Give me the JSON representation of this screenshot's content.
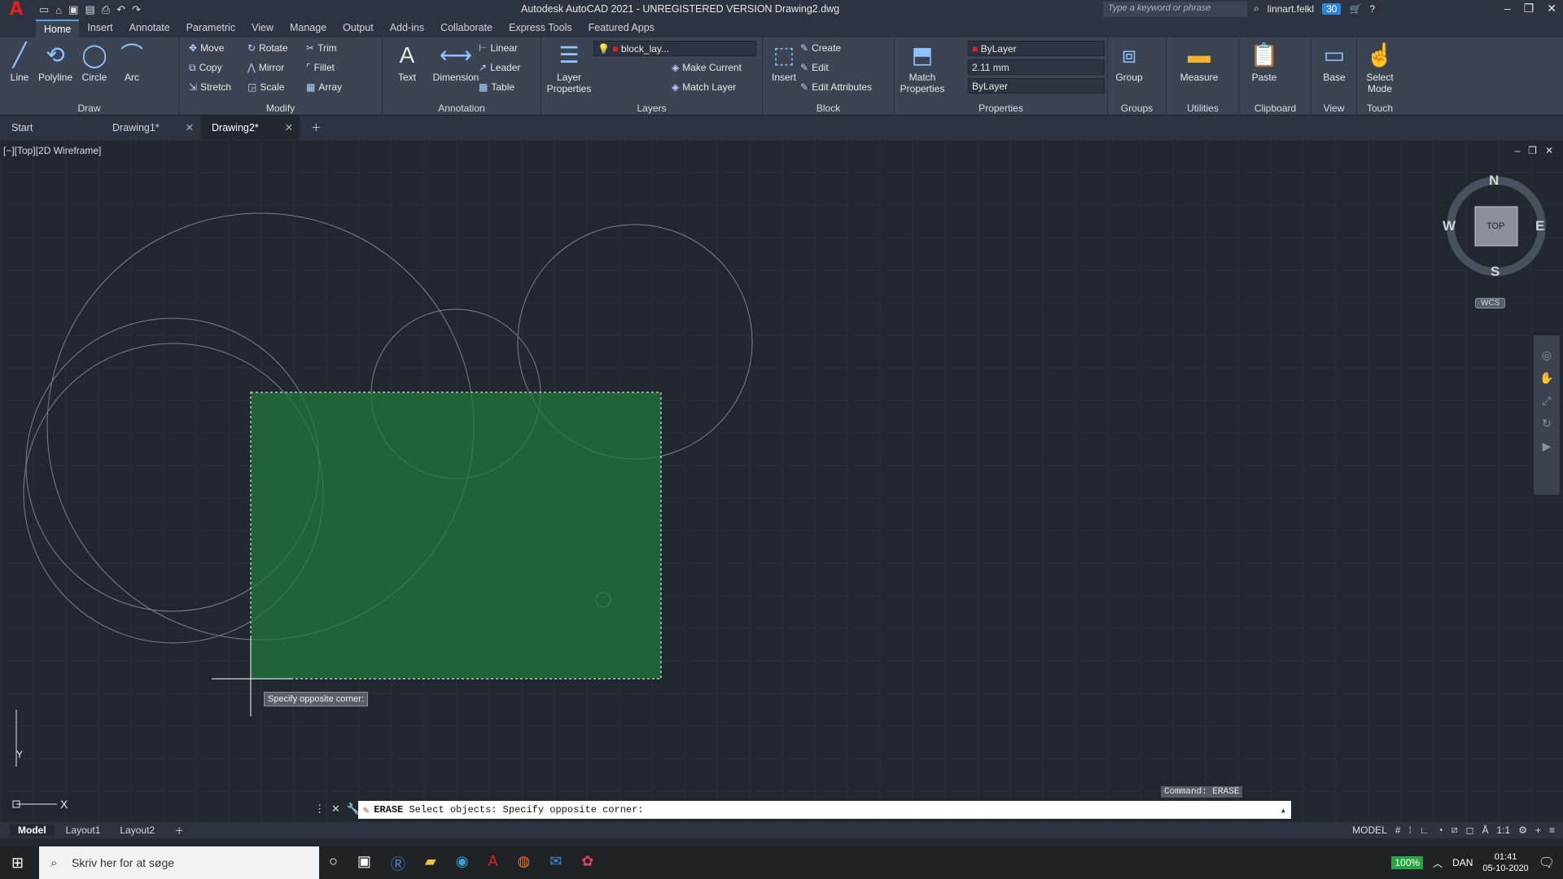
{
  "title": {
    "app": "A",
    "text": "Autodesk AutoCAD 2021 - UNREGISTERED VERSION    Drawing2.dwg",
    "search_placeholder": "Type a keyword or phrase",
    "user": "linnart.felkl",
    "badge": "30"
  },
  "menu": [
    "Home",
    "Insert",
    "Annotate",
    "Parametric",
    "View",
    "Manage",
    "Output",
    "Add-ins",
    "Collaborate",
    "Express Tools",
    "Featured Apps"
  ],
  "ribbon": {
    "draw": {
      "label": "Draw",
      "items": [
        "Line",
        "Polyline",
        "Circle",
        "Arc"
      ]
    },
    "modify": {
      "label": "Modify",
      "items": [
        "Move",
        "Rotate",
        "Trim",
        "Copy",
        "Mirror",
        "Fillet",
        "Stretch",
        "Scale",
        "Array"
      ]
    },
    "annotation": {
      "label": "Annotation",
      "items": [
        "Text",
        "Dimension",
        "Linear",
        "Leader",
        "Table"
      ]
    },
    "layers": {
      "label": "Layers",
      "props": "Layer Properties",
      "layer_name": "block_lay...",
      "make_current": "Make Current",
      "match_layer": "Match Layer"
    },
    "block": {
      "label": "Block",
      "insert": "Insert",
      "create": "Create",
      "edit": "Edit",
      "edit_attributes": "Edit Attributes"
    },
    "properties": {
      "label": "Properties",
      "match": "Match Properties",
      "color": "ByLayer",
      "lineweight": "2.11 mm",
      "linetype": "ByLayer"
    },
    "groups": {
      "label": "Groups",
      "group": "Group"
    },
    "utilities": {
      "label": "Utilities",
      "measure": "Measure"
    },
    "clipboard": {
      "label": "Clipboard",
      "paste": "Paste"
    },
    "view": {
      "label": "View",
      "base": "Base"
    },
    "touch": {
      "label": "Touch",
      "select_mode": "Select Mode"
    }
  },
  "doc_tabs": [
    {
      "label": "Start",
      "closable": false,
      "active": false
    },
    {
      "label": "Drawing1*",
      "closable": true,
      "active": false
    },
    {
      "label": "Drawing2*",
      "closable": true,
      "active": true
    }
  ],
  "viewport": {
    "label": "[−][Top][2D Wireframe]",
    "tooltip": "Specify opposite corner:",
    "compass": {
      "n": "N",
      "s": "S",
      "e": "E",
      "w": "W",
      "top": "TOP",
      "wcs": "WCS"
    },
    "ucs_x": "X",
    "ucs_y": "Y"
  },
  "command": {
    "history": "Command: ERASE",
    "prompt_cmd": "ERASE",
    "prompt_text": "Select objects: Specify opposite corner:"
  },
  "layouts": [
    "Model",
    "Layout1",
    "Layout2"
  ],
  "status": {
    "mode": "MODEL",
    "scale": "1:1"
  },
  "taskbar": {
    "search": "Skriv her for at søge",
    "zoom": "100%",
    "lang": "DAN",
    "time": "01:41",
    "date": "05-10-2020"
  }
}
